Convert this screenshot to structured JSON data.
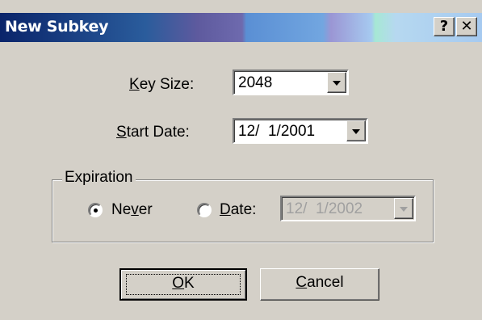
{
  "window": {
    "title": "New Subkey",
    "help_glyph": "?",
    "close_glyph": "✕"
  },
  "key_size": {
    "label_mnemonic": "K",
    "label_rest": "ey Size:",
    "value": "2048"
  },
  "start_date": {
    "label_mnemonic": "S",
    "label_rest": "tart Date:",
    "value": "12/  1/2001"
  },
  "expiration": {
    "legend": "Expiration",
    "never": {
      "pre": "Ne",
      "mnemonic": "v",
      "post": "er",
      "selected": true
    },
    "date": {
      "pre": "",
      "mnemonic": "D",
      "post": "ate:",
      "selected": false,
      "value": "12/  1/2002",
      "enabled": false
    }
  },
  "buttons": {
    "ok_mnemonic": "O",
    "ok_rest": "K",
    "cancel_mnemonic": "C",
    "cancel_rest": "ancel"
  },
  "colors": {
    "dialog_bg": "#d4d0c8",
    "title_start": "#0a246a",
    "title_end": "#a6caf0"
  }
}
